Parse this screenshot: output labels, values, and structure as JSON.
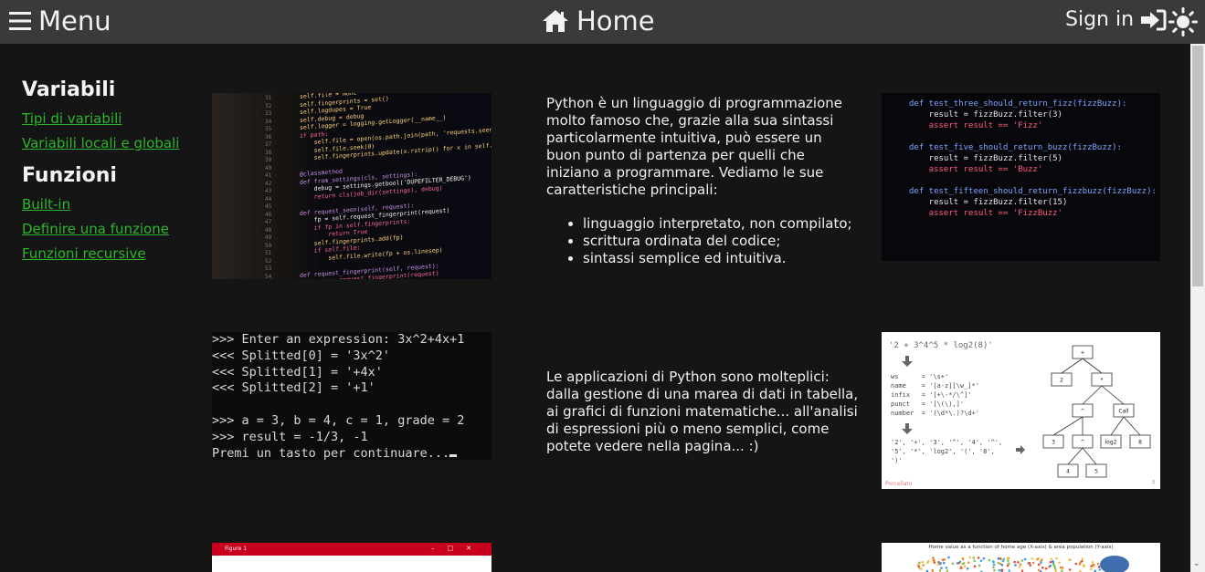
{
  "header": {
    "menu_label": "Menu",
    "home_label": "Home",
    "signin_label": "Sign in"
  },
  "sidebar": {
    "sections": [
      {
        "title": "Variabili",
        "links": [
          "Tipi di variabili",
          "Variabili locali e globali"
        ]
      },
      {
        "title": "Funzioni",
        "links": [
          "Built-in",
          "Definire una funzione",
          "Funzioni recursive"
        ]
      }
    ]
  },
  "content": {
    "intro_text": "Python è un linguaggio di programmazione molto famoso che, grazie alla sua sintassi particolarmente intuitiva, può essere un buon punto di partenza per quelli che iniziano a programmare. Vediamo le sue caratteristiche principali:",
    "features": [
      "linguaggio interpretato, non compilato;",
      "scrittura ordinata del codice;",
      "sintassi semplice ed intuitiva."
    ],
    "applications_text": "Le applicazioni di Python sono molteplici: dalla gestione di una marea di dati in tabella, ai grafici di funzioni matematiche... all'analisi di espressioni più o meno semplici, come potete vedere nella pagina... :)"
  },
  "images": {
    "code_screen_lines": [
      "self.file = None",
      "self.fingerprints = set()",
      "self.logdupes = True",
      "self.debug = debug",
      "self.logger = logging.getLogger(__name__)",
      "if path:",
      "    self.file = open(os.path.join(path, 'requests.seen'), 'a+')",
      "    self.file.seek(0)",
      "    self.fingerprints.update(x.rstrip() for x in self.file)",
      "",
      "@classmethod",
      "def from_settings(cls, settings):",
      "    debug = settings.getbool('DUPEFILTER_DEBUG')",
      "    return cls(job_dir(settings), debug)",
      "",
      "def request_seen(self, request):",
      "    fp = self.request_fingerprint(request)",
      "    if fp in self.fingerprints:",
      "        return True",
      "    self.fingerprints.add(fp)",
      "    if self.file:",
      "        self.file.write(fp + os.linesep)",
      "",
      "def request_fingerprint(self, request):",
      "    return request_fingerprint(request)"
    ],
    "test_code_lines": [
      "def test_three_should_return_fizz(fizzBuzz):",
      "    result = fizzBuzz.filter(3)",
      "    assert result == 'Fizz'",
      "",
      "def test_five_should_return_buzz(fizzBuzz):",
      "    result = fizzBuzz.filter(5)",
      "    assert result == 'Buzz'",
      "",
      "def test_fifteen_should_return_fizzbuzz(fizzBuzz):",
      "    result = fizzBuzz.filter(15)",
      "    assert result == 'FizzBuzz'"
    ],
    "terminal_lines": [
      ">>> Enter an expression: 3x^2+4x+1",
      "<<< Splitted[0] = '3x^2'",
      "<<< Splitted[1] = '+4x'",
      "<<< Splitted[2] = '+1'",
      "",
      ">>> a = 3, b = 4, c = 1, grade = 2",
      ">>> result = -1/3, -1",
      "Premi un tasto per continuare..."
    ],
    "tree_expression": "'2 + 3^4^5 * log2(8)'",
    "tree_regex": "ws      = '\\s+'\nname    = '[a-z][\\w_]*'\ninfix   = '[+\\-*/\\^]'\npunct   = '[\\(\\),]'\nnumber  = '(\\d*\\.)?\\d+'",
    "tree_tokens": "'2', '+', '3', '^', '4', '^',\n'5', '*', 'log2', '(', '8',\n')'",
    "tree_nodes": [
      "+",
      "2",
      "*",
      "^",
      "Call",
      "3",
      "^",
      "log2",
      "8",
      "4",
      "5"
    ],
    "tree_brand": "Porcellato",
    "tree_page": "3",
    "figure_title": "Figure 1",
    "scatter_title": "Home value as a function of home age (X-axis) & area population (Y-axis)"
  }
}
